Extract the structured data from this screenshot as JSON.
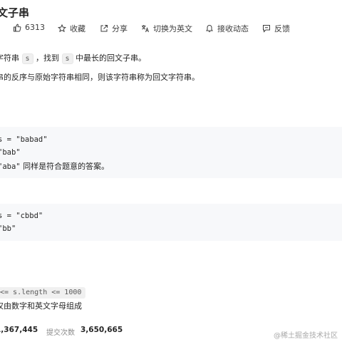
{
  "problem": {
    "title": "文子串"
  },
  "toolbar": {
    "likes_count": "6313",
    "favorite_label": "收藏",
    "share_label": "分享",
    "translate_label": "切换为英文",
    "notify_label": "接收动态",
    "feedback_label": "反馈"
  },
  "description": {
    "line1_pre": "字符串",
    "line1_code1": "s",
    "line1_mid": "，找到",
    "line1_code2": "s",
    "line1_post": "中最长的回文子串。",
    "line2": "串的反序与原始字符串相同，则该字符串称为回文字符串。"
  },
  "example1": {
    "input": "s = \"babad\"",
    "output": "\"bab\"",
    "explain_code": "\"aba\"",
    "explain_text": " 同样是符合题意的答案。"
  },
  "example2": {
    "input": "s = \"cbbd\"",
    "output": "\"bb\""
  },
  "constraints": {
    "line1": "<= s.length <= 1000",
    "line2": "仅由数字和英文字母组成"
  },
  "stats": {
    "accepted_value": "1,367,445",
    "submissions_label": "提交次数",
    "submissions_value": "3,650,665"
  },
  "watermark": "@稀土掘金技术社区"
}
